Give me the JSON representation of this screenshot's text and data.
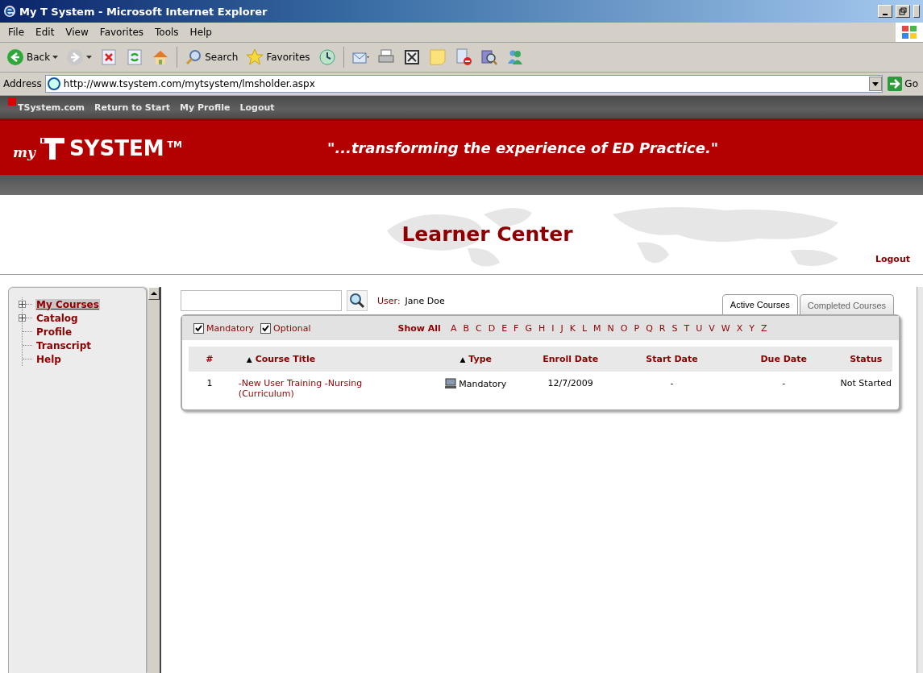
{
  "window": {
    "title": "My T System - Microsoft Internet Explorer"
  },
  "menu": [
    "File",
    "Edit",
    "View",
    "Favorites",
    "Tools",
    "Help"
  ],
  "toolbar": [
    {
      "kind": "back",
      "label": "Back"
    },
    {
      "kind": "forward"
    },
    {
      "kind": "stop"
    },
    {
      "kind": "refresh"
    },
    {
      "kind": "home"
    },
    {
      "kind": "search",
      "label": "Search"
    },
    {
      "kind": "favorites",
      "label": "Favorites"
    },
    {
      "kind": "history"
    },
    {
      "kind": "mail"
    },
    {
      "kind": "print"
    },
    {
      "kind": "edit"
    },
    {
      "kind": "note"
    },
    {
      "kind": "block"
    },
    {
      "kind": "research"
    },
    {
      "kind": "messenger"
    }
  ],
  "address": {
    "label": "Address",
    "value": "http://www.tsystem.com/mytsystem/lmsholder.aspx",
    "go": "Go"
  },
  "site_nav": [
    "TSystem.com",
    "Return to Start",
    "My Profile",
    "Logout"
  ],
  "banner": {
    "logo_prefix": "my",
    "logo": "SYSTEM",
    "logo_mark": "TM",
    "tagline": "\"...transforming the experience of ED Practice.\""
  },
  "page": {
    "title": "Learner Center",
    "logout": "Logout"
  },
  "sidebar": {
    "items": [
      {
        "label": "My Courses",
        "expandable": true,
        "selected": true
      },
      {
        "label": "Catalog",
        "expandable": true,
        "selected": false
      },
      {
        "label": "Profile",
        "expandable": false,
        "selected": false
      },
      {
        "label": "Transcript",
        "expandable": false,
        "selected": false
      },
      {
        "label": "Help",
        "expandable": false,
        "selected": false
      }
    ]
  },
  "user": {
    "label": "User:",
    "name": "Jane Doe"
  },
  "tabs": [
    {
      "label": "Active Courses",
      "selected": true
    },
    {
      "label": "Completed Courses",
      "selected": false
    }
  ],
  "filters": [
    {
      "label": "Mandatory",
      "checked": true
    },
    {
      "label": "Optional",
      "checked": true
    }
  ],
  "show_all": "Show All",
  "letters": [
    "A",
    "B",
    "C",
    "D",
    "E",
    "F",
    "G",
    "H",
    "I",
    "J",
    "K",
    "L",
    "M",
    "N",
    "O",
    "P",
    "Q",
    "R",
    "S",
    "T",
    "U",
    "V",
    "W",
    "X",
    "Y",
    "Z"
  ],
  "table": {
    "columns": [
      {
        "label": "#"
      },
      {
        "label": "Course Title",
        "sort_icon": "▲"
      },
      {
        "label": "Type",
        "sort_icon": "▲"
      },
      {
        "label": "Enroll Date"
      },
      {
        "label": "Start Date"
      },
      {
        "label": "Due Date"
      },
      {
        "label": "Status"
      }
    ],
    "rows": [
      {
        "number": "1",
        "title": "-New User Training -Nursing (Curriculum)",
        "type": "Mandatory",
        "enroll_date": "12/7/2009",
        "start_date": "-",
        "due_date": "-",
        "status": "Not Started"
      }
    ]
  }
}
